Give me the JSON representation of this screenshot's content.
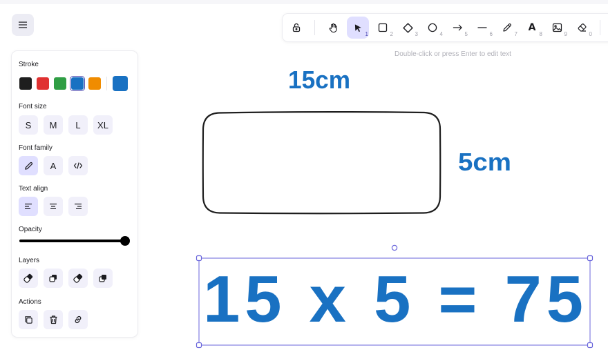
{
  "app": {
    "hint": "Double-click or press Enter to edit text"
  },
  "toolbar": {
    "tools": [
      {
        "name": "lock",
        "icon": "lock-icon",
        "num": ""
      },
      {
        "name": "hand",
        "icon": "hand-icon",
        "num": ""
      },
      {
        "name": "selection",
        "icon": "pointer-icon",
        "num": "1",
        "active": true
      },
      {
        "name": "rectangle",
        "icon": "rectangle-icon",
        "num": "2"
      },
      {
        "name": "diamond",
        "icon": "diamond-icon",
        "num": "3"
      },
      {
        "name": "ellipse",
        "icon": "ellipse-icon",
        "num": "4"
      },
      {
        "name": "arrow",
        "icon": "arrow-icon",
        "num": "5"
      },
      {
        "name": "line",
        "icon": "line-icon",
        "num": "6"
      },
      {
        "name": "draw",
        "icon": "pencil-icon",
        "num": "7"
      },
      {
        "name": "text",
        "icon": "text-icon",
        "num": "8"
      },
      {
        "name": "image",
        "icon": "image-icon",
        "num": "9"
      },
      {
        "name": "eraser",
        "icon": "eraser-icon",
        "num": "0"
      }
    ]
  },
  "panel": {
    "stroke_label": "Stroke",
    "stroke_colors": [
      "#1e1e1e",
      "#e03131",
      "#2f9e44",
      "#1971c2",
      "#f08c00"
    ],
    "stroke_selected": "#1971c2",
    "font_size_label": "Font size",
    "font_sizes": [
      "S",
      "M",
      "L",
      "XL"
    ],
    "font_family_label": "Font family",
    "font_family_hand_glyph": "A",
    "text_align_label": "Text align",
    "opacity_label": "Opacity",
    "opacity_value": 100,
    "layers_label": "Layers",
    "actions_label": "Actions"
  },
  "canvas": {
    "label_width": "15cm",
    "label_height": "5cm",
    "equation": "15 x 5 = 75",
    "stroke_color": "#1e1e1e",
    "text_color": "#1971c2",
    "selection_color": "#6965db"
  }
}
